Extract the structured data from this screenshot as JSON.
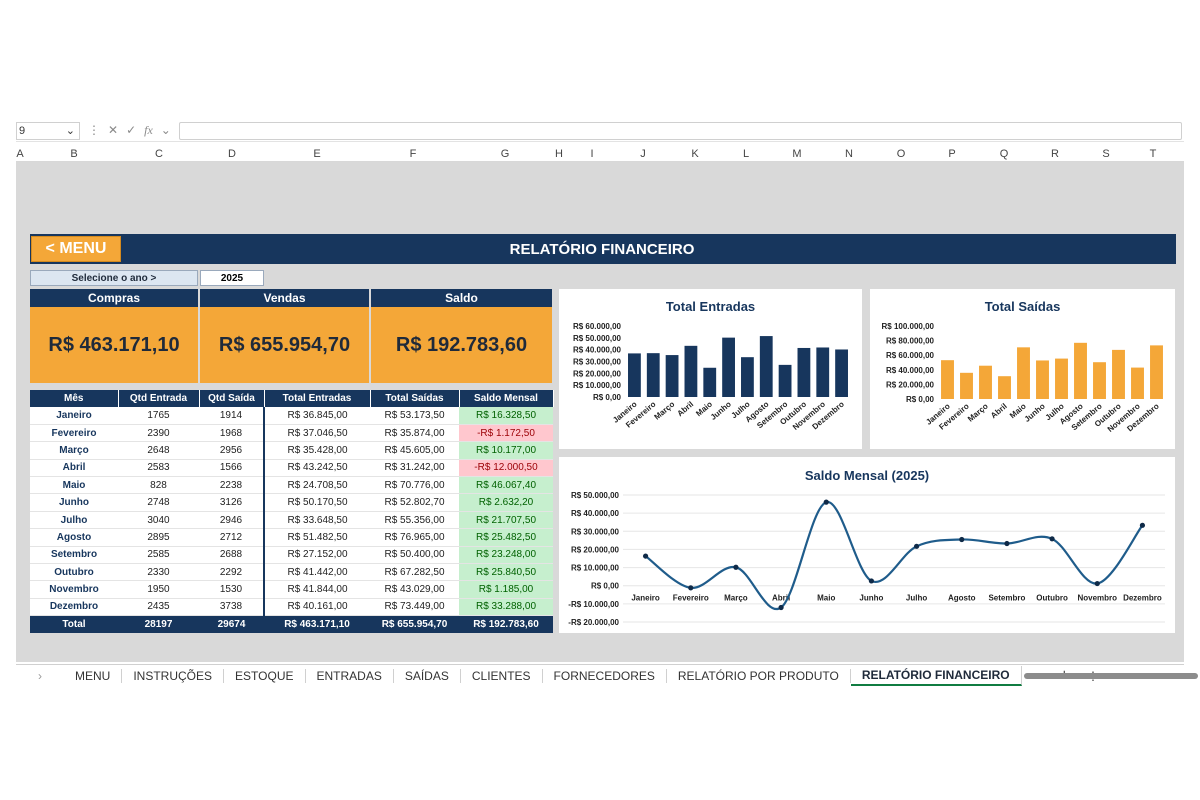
{
  "formula_bar": {
    "cell_ref": "9",
    "fx": "fx"
  },
  "columns": [
    "A",
    "B",
    "C",
    "D",
    "E",
    "F",
    "G",
    "H",
    "I",
    "J",
    "K",
    "L",
    "M",
    "N",
    "O",
    "P",
    "Q",
    "R",
    "S",
    "T"
  ],
  "header": {
    "menu_label": "< MENU",
    "title": "RELATÓRIO FINANCEIRO"
  },
  "year_select": {
    "label": "Selecione o ano >",
    "value": "2025"
  },
  "kpis": [
    {
      "label": "Compras",
      "value": "R$ 463.171,10"
    },
    {
      "label": "Vendas",
      "value": "R$ 655.954,70"
    },
    {
      "label": "Saldo",
      "value": "R$ 192.783,60"
    }
  ],
  "table": {
    "headers": [
      "Mês",
      "Qtd Entrada",
      "Qtd Saída",
      "Total Entradas",
      "Total Saídas",
      "Saldo Mensal"
    ],
    "rows": [
      [
        "Janeiro",
        "1765",
        "1914",
        "R$ 36.845,00",
        "R$ 53.173,50",
        "R$ 16.328,50"
      ],
      [
        "Fevereiro",
        "2390",
        "1968",
        "R$ 37.046,50",
        "R$ 35.874,00",
        "-R$ 1.172,50"
      ],
      [
        "Março",
        "2648",
        "2956",
        "R$ 35.428,00",
        "R$ 45.605,00",
        "R$ 10.177,00"
      ],
      [
        "Abril",
        "2583",
        "1566",
        "R$ 43.242,50",
        "R$ 31.242,00",
        "-R$ 12.000,50"
      ],
      [
        "Maio",
        "828",
        "2238",
        "R$ 24.708,50",
        "R$ 70.776,00",
        "R$ 46.067,40"
      ],
      [
        "Junho",
        "2748",
        "3126",
        "R$ 50.170,50",
        "R$ 52.802,70",
        "R$ 2.632,20"
      ],
      [
        "Julho",
        "3040",
        "2946",
        "R$ 33.648,50",
        "R$ 55.356,00",
        "R$ 21.707,50"
      ],
      [
        "Agosto",
        "2895",
        "2712",
        "R$ 51.482,50",
        "R$ 76.965,00",
        "R$ 25.482,50"
      ],
      [
        "Setembro",
        "2585",
        "2688",
        "R$ 27.152,00",
        "R$ 50.400,00",
        "R$ 23.248,00"
      ],
      [
        "Outubro",
        "2330",
        "2292",
        "R$ 41.442,00",
        "R$ 67.282,50",
        "R$ 25.840,50"
      ],
      [
        "Novembro",
        "1950",
        "1530",
        "R$ 41.844,00",
        "R$ 43.029,00",
        "R$ 1.185,00"
      ],
      [
        "Dezembro",
        "2435",
        "3738",
        "R$ 40.161,00",
        "R$ 73.449,00",
        "R$ 33.288,00"
      ]
    ],
    "total": [
      "Total",
      "28197",
      "29674",
      "R$ 463.171,10",
      "R$ 655.954,70",
      "R$ 192.783,60"
    ]
  },
  "chart_data": [
    {
      "type": "bar",
      "title": "Total Entradas",
      "categories": [
        "Janeiro",
        "Fevereiro",
        "Março",
        "Abril",
        "Maio",
        "Junho",
        "Julho",
        "Agosto",
        "Setembro",
        "Outubro",
        "Novembro",
        "Dezembro"
      ],
      "values": [
        36845,
        37046.5,
        35428,
        43242.5,
        24708.5,
        50170.5,
        33648.5,
        51482.5,
        27152,
        41442,
        41844,
        40161
      ],
      "ylim": [
        0,
        60000
      ],
      "yticks": [
        "R$ 0,00",
        "R$ 10.000,00",
        "R$ 20.000,00",
        "R$ 30.000,00",
        "R$ 40.000,00",
        "R$ 50.000,00",
        "R$ 60.000,00"
      ],
      "color": "#17365d"
    },
    {
      "type": "bar",
      "title": "Total Saídas",
      "categories": [
        "Janeiro",
        "Fevereiro",
        "Março",
        "Abril",
        "Maio",
        "Junho",
        "Julho",
        "Agosto",
        "Setembro",
        "Outubro",
        "Novembro",
        "Dezembro"
      ],
      "values": [
        53173.5,
        35874,
        45605,
        31242,
        70776,
        52802.7,
        55356,
        76965,
        50400,
        67282.5,
        43029,
        73449
      ],
      "ylim": [
        0,
        100000
      ],
      "yticks": [
        "R$ 0,00",
        "R$ 20.000,00",
        "R$ 40.000,00",
        "R$ 60.000,00",
        "R$ 80.000,00",
        "R$ 100.000,00"
      ],
      "color": "#f4a738"
    },
    {
      "type": "line",
      "title": "Saldo Mensal (2025)",
      "categories": [
        "Janeiro",
        "Fevereiro",
        "Março",
        "Abril",
        "Maio",
        "Junho",
        "Julho",
        "Agosto",
        "Setembro",
        "Outubro",
        "Novembro",
        "Dezembro"
      ],
      "values": [
        16328.5,
        -1172.5,
        10177,
        -12000.5,
        46067.4,
        2632.2,
        21707.5,
        25482.5,
        23248,
        25840.5,
        1185,
        33288
      ],
      "ylim": [
        -20000,
        50000
      ],
      "yticks": [
        "-R$ 20.000,00",
        "-R$ 10.000,00",
        "R$ 0,00",
        "R$ 10.000,00",
        "R$ 20.000,00",
        "R$ 30.000,00",
        "R$ 40.000,00",
        "R$ 50.000,00"
      ],
      "color": "#1f5c8b"
    }
  ],
  "tabs": [
    "MENU",
    "INSTRUÇÕES",
    "ESTOQUE",
    "ENTRADAS",
    "SAÍDAS",
    "CLIENTES",
    "FORNECEDORES",
    "RELATÓRIO POR PRODUTO",
    "RELATÓRIO FINANCEIRO"
  ],
  "active_tab": "RELATÓRIO FINANCEIRO",
  "icons": {
    "nav": "chevron-right-icon",
    "add": "plus-icon",
    "more": "more-options-icon"
  }
}
